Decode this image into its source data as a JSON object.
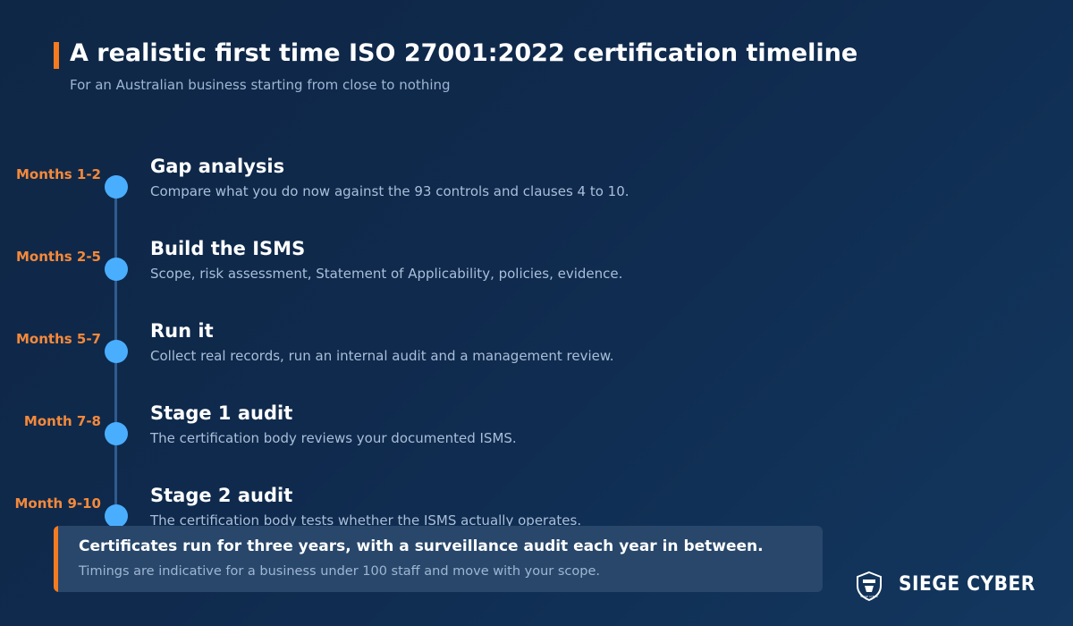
{
  "header": {
    "title": "A realistic first time ISO 27001:2022 certification timeline",
    "subtitle": "For an Australian business starting from close to nothing"
  },
  "steps": [
    {
      "period": "Months 1-2",
      "heading": "Gap analysis",
      "description": "Compare what you do now against the 93 controls and clauses 4 to 10."
    },
    {
      "period": "Months 2-5",
      "heading": "Build the ISMS",
      "description": "Scope, risk assessment, Statement of Applicability, policies, evidence."
    },
    {
      "period": "Months 5-7",
      "heading": "Run it",
      "description": "Collect real records, run an internal audit and a management review."
    },
    {
      "period": "Month 7-8",
      "heading": "Stage 1 audit",
      "description": "The certification body reviews your documented ISMS."
    },
    {
      "period": "Month 9-10",
      "heading": "Stage 2 audit",
      "description": "The certification body tests whether the ISMS actually operates."
    }
  ],
  "note": {
    "main": "Certificates run for three years, with a surveillance audit each year in between.",
    "sub": "Timings are indicative for a business under 100 staff and move with your scope."
  },
  "brand": {
    "name": "SIEGE CYBER",
    "logo_icon": "shield-icon",
    "logo_text": "SIEGE CYBER"
  },
  "colors": {
    "accent": "#f47b20",
    "period": "#f5893a",
    "dot": "#4aaeff",
    "line": "#2f5b8f",
    "background": "#0f2746"
  }
}
